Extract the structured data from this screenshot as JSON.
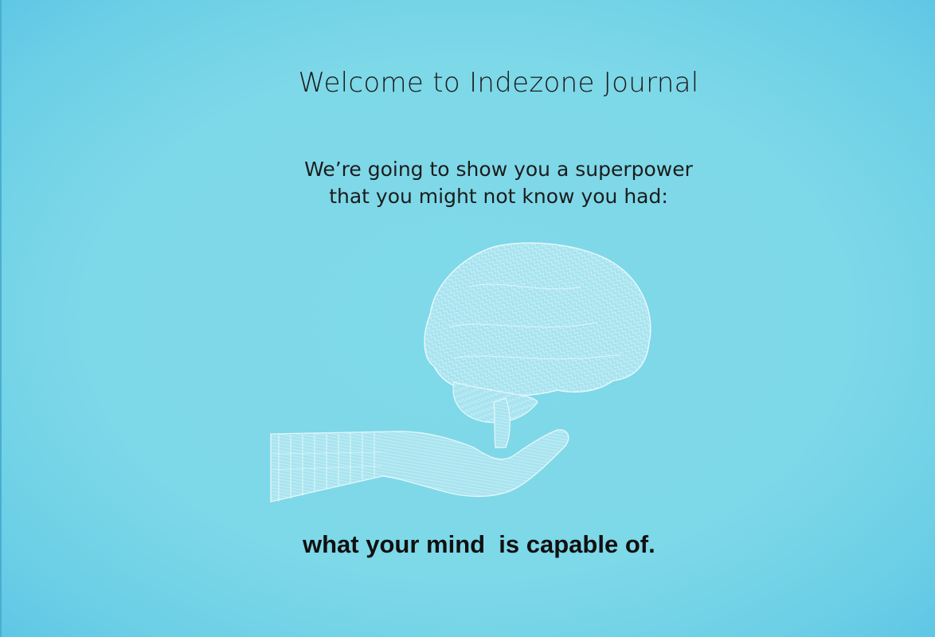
{
  "heading": {
    "title": "Welcome to Indezone Journal"
  },
  "intro": {
    "line1": "We’re going to show you a superpower",
    "line2": "that you might not know you had:"
  },
  "illustration": {
    "icon": "brain-in-hand-icon",
    "stroke_color": "#d8f2fa"
  },
  "tagline": {
    "text": "what your mind  is capable of."
  },
  "colors": {
    "background": "#7dd8e8",
    "text": "#1c1c1c"
  }
}
